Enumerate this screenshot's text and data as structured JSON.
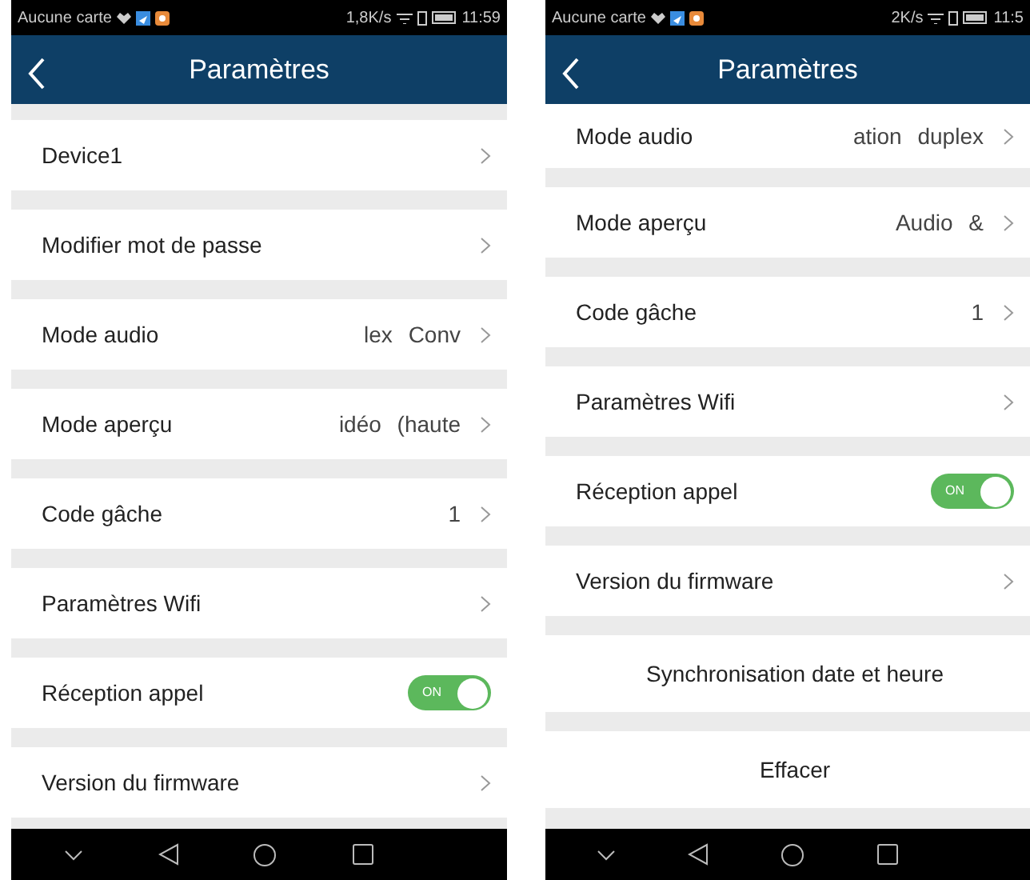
{
  "phones": [
    {
      "status_bar": {
        "carrier": "Aucune carte",
        "speed": "1,8K/s",
        "time": "11:59"
      },
      "header": {
        "title": "Paramètres"
      },
      "scrolled": false,
      "rows": [
        {
          "kind": "link",
          "label": "Device1"
        },
        {
          "kind": "link",
          "label": "Modifier mot de passe"
        },
        {
          "kind": "link",
          "label": "Mode audio",
          "value": "lex Conv"
        },
        {
          "kind": "link",
          "label": "Mode aperçu",
          "value": "idéo (haute"
        },
        {
          "kind": "link",
          "label": "Code gâche",
          "value": "1"
        },
        {
          "kind": "link",
          "label": "Paramètres Wifi"
        },
        {
          "kind": "toggle",
          "label": "Réception appel",
          "on": true,
          "on_text": "ON"
        },
        {
          "kind": "link",
          "label": "Version du firmware"
        }
      ]
    },
    {
      "status_bar": {
        "carrier": "Aucune carte",
        "speed": "2K/s",
        "time": "11:5"
      },
      "header": {
        "title": "Paramètres"
      },
      "scrolled": true,
      "rows": [
        {
          "kind": "link",
          "label": "Mode audio",
          "value": "ation duplex"
        },
        {
          "kind": "link",
          "label": "Mode aperçu",
          "value": "Audio &"
        },
        {
          "kind": "link",
          "label": "Code gâche",
          "value": "1"
        },
        {
          "kind": "link",
          "label": "Paramètres Wifi"
        },
        {
          "kind": "toggle",
          "label": "Réception appel",
          "on": true,
          "on_text": "ON"
        },
        {
          "kind": "link",
          "label": "Version du firmware"
        },
        {
          "kind": "action",
          "label": "Synchronisation date et heure"
        },
        {
          "kind": "action",
          "label": "Effacer"
        }
      ]
    }
  ]
}
